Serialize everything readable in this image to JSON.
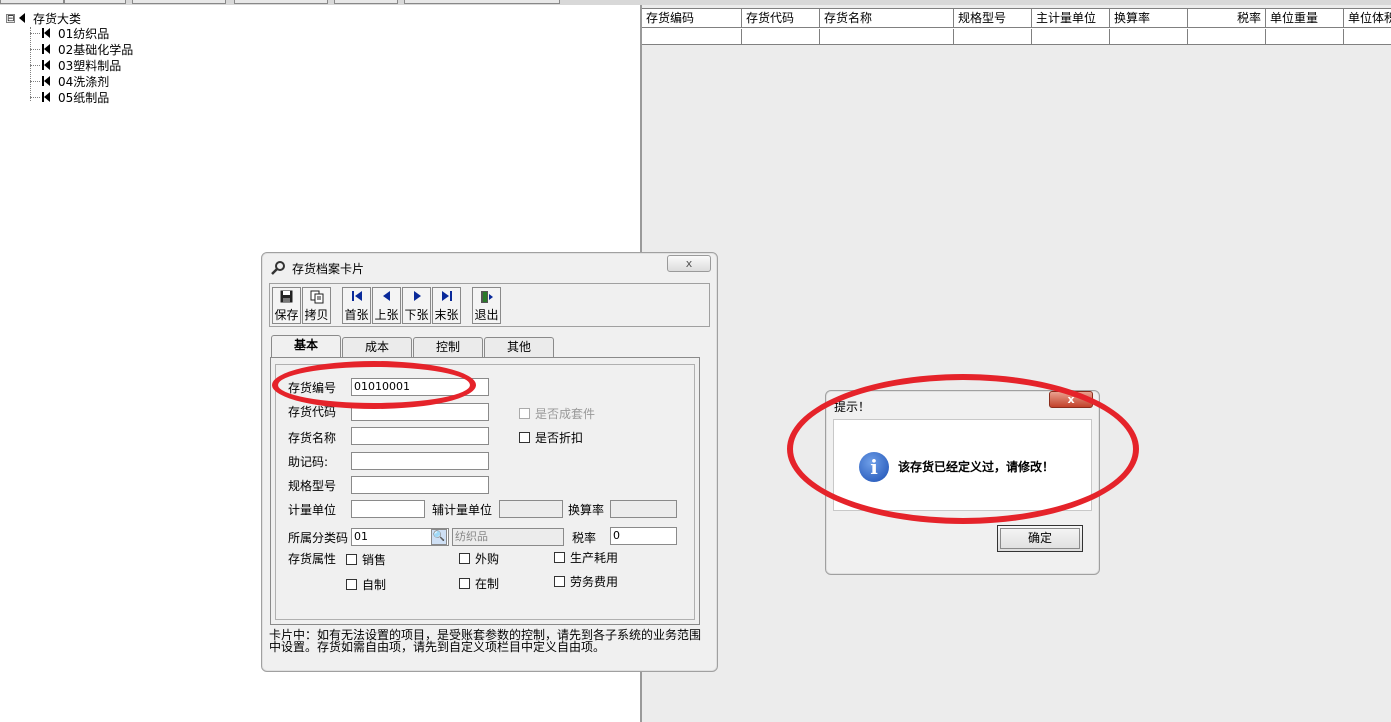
{
  "tree": {
    "root_label": "存货大类",
    "expander": "⊟",
    "items": [
      {
        "label": "01纺织品"
      },
      {
        "label": "02基础化学品"
      },
      {
        "label": "03塑料制品"
      },
      {
        "label": "04洗涤剂"
      },
      {
        "label": "05纸制品"
      }
    ]
  },
  "grid": {
    "columns": [
      "存货编码",
      "存货代码",
      "存货名称",
      "规格型号",
      "主计量单位",
      "换算率",
      "税率",
      "单位重量",
      "单位体积"
    ]
  },
  "card_window": {
    "title": "存货档案卡片",
    "close_label": "x",
    "toolbar": {
      "save": "保存",
      "copy": "拷贝",
      "first": "首张",
      "prev": "上张",
      "next": "下张",
      "last": "末张",
      "exit": "退出"
    },
    "tabs": [
      "基本",
      "成本",
      "控制",
      "其他"
    ],
    "form": {
      "code_label": "存货编号",
      "code_value": "01010001",
      "alias_label": "存货代码",
      "name_label": "存货名称",
      "mnemonic_label": "助记码:",
      "spec_label": "规格型号",
      "unit_label": "计量单位",
      "aux_unit_label": "辅计量单位",
      "rate_label": "换算率",
      "category_label": "所属分类码",
      "category_value": "01",
      "category_name": "纺织品",
      "tax_label": "税率",
      "tax_value": "0",
      "attr_label": "存货属性",
      "is_kit_label": "是否成套件",
      "is_discount_label": "是否折扣",
      "sale_label": "销售",
      "purchase_label": "外购",
      "production_label": "生产耗用",
      "self_made_label": "自制",
      "in_process_label": "在制",
      "service_label": "劳务费用"
    },
    "note": "卡片中：如有无法设置的项目，是受账套参数的控制，请先到各子系统的业务范围中设置。存货如需自由项，请先到自定义项栏目中定义自由项。"
  },
  "dialog": {
    "title": "提示！",
    "close_label": "x",
    "message": "该存货已经定义过，请修改！",
    "ok_label": "确定"
  },
  "colors": {
    "annotation": "#e5232a",
    "info_icon": "#1a4eb3"
  }
}
